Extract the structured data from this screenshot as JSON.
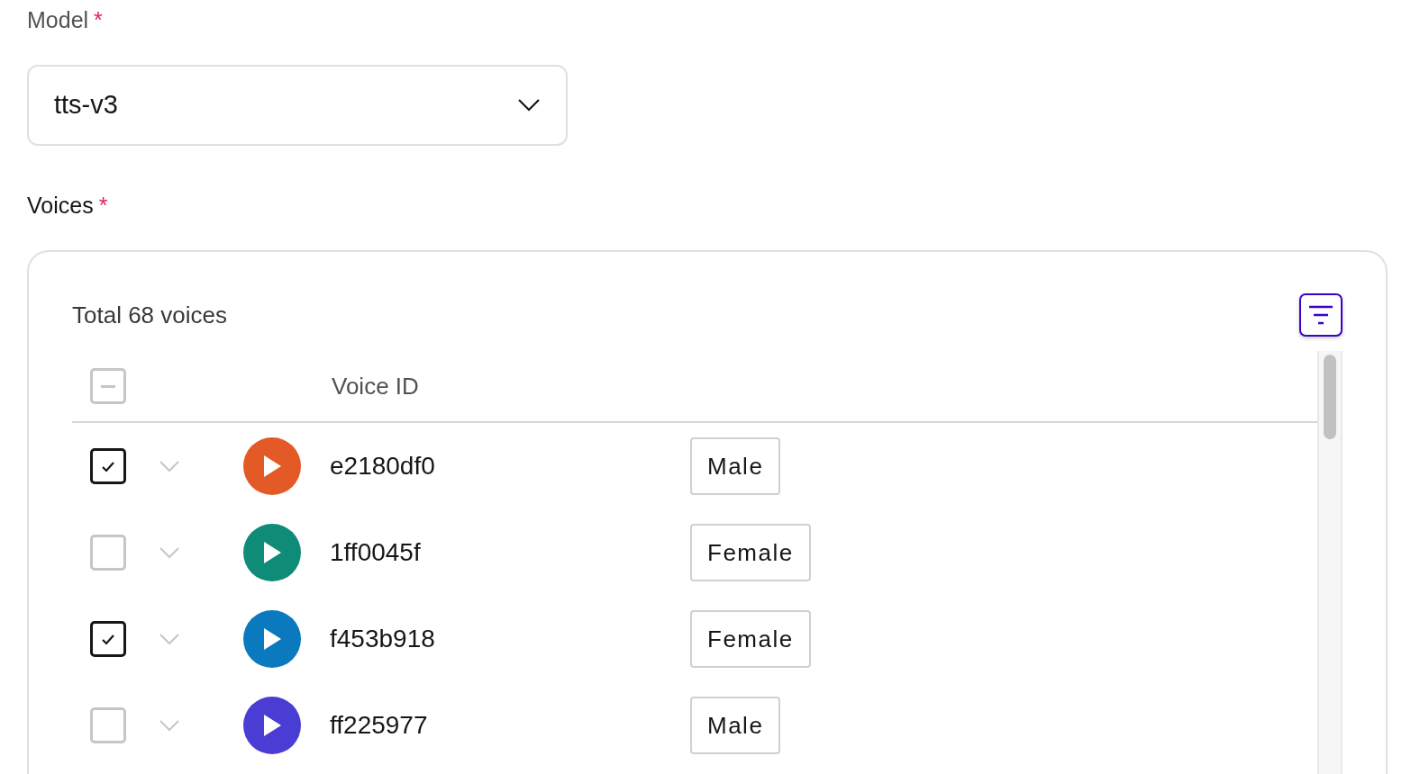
{
  "model": {
    "label": "Model",
    "required_mark": "*",
    "value": "tts-v3"
  },
  "voices": {
    "label": "Voices",
    "required_mark": "*",
    "total": "Total 68 voices",
    "header": {
      "indeterminate": true,
      "column": "Voice ID"
    },
    "rows": [
      {
        "checked": true,
        "color": "#e45a26",
        "id": "e2180df0",
        "gender": "Male"
      },
      {
        "checked": false,
        "color": "#0e8c78",
        "id": "1ff0045f",
        "gender": "Female"
      },
      {
        "checked": true,
        "color": "#0b79bd",
        "id": "f453b918",
        "gender": "Female"
      },
      {
        "checked": false,
        "color": "#4a3dd4",
        "id": "ff225977",
        "gender": "Male"
      }
    ]
  }
}
